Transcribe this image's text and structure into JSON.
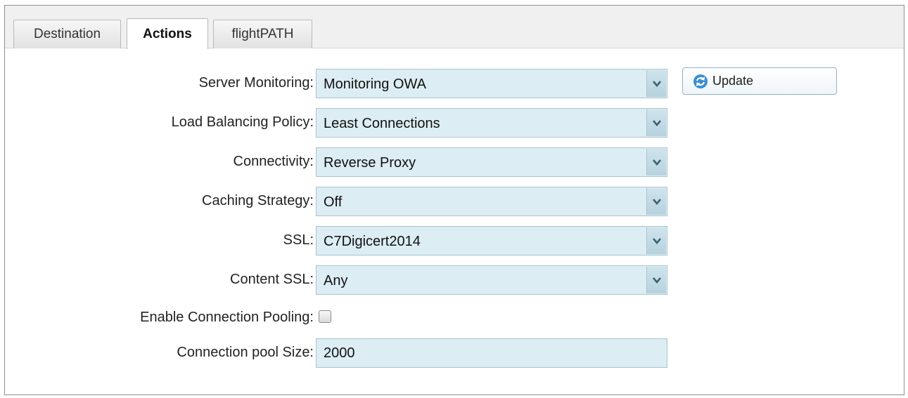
{
  "tabs": [
    {
      "label": "Destination",
      "active": false
    },
    {
      "label": "Actions",
      "active": true
    },
    {
      "label": "flightPATH",
      "active": false
    }
  ],
  "form": {
    "server_monitoring": {
      "label": "Server Monitoring:",
      "value": "Monitoring OWA"
    },
    "load_balancing": {
      "label": "Load Balancing Policy:",
      "value": "Least Connections"
    },
    "connectivity": {
      "label": "Connectivity:",
      "value": "Reverse Proxy"
    },
    "caching": {
      "label": "Caching Strategy:",
      "value": "Off"
    },
    "ssl": {
      "label": "SSL:",
      "value": "C7Digicert2014"
    },
    "content_ssl": {
      "label": "Content SSL:",
      "value": "Any"
    },
    "pooling": {
      "label": "Enable Connection Pooling:",
      "checked": false
    },
    "pool_size": {
      "label": "Connection pool Size:",
      "value": "2000"
    }
  },
  "update_button": {
    "label": "Update",
    "icon": "refresh-icon"
  },
  "colors": {
    "field_bg": "#dcedf3",
    "field_border": "#a9c4cf",
    "tabbar_bg": "#f0f0f0"
  }
}
